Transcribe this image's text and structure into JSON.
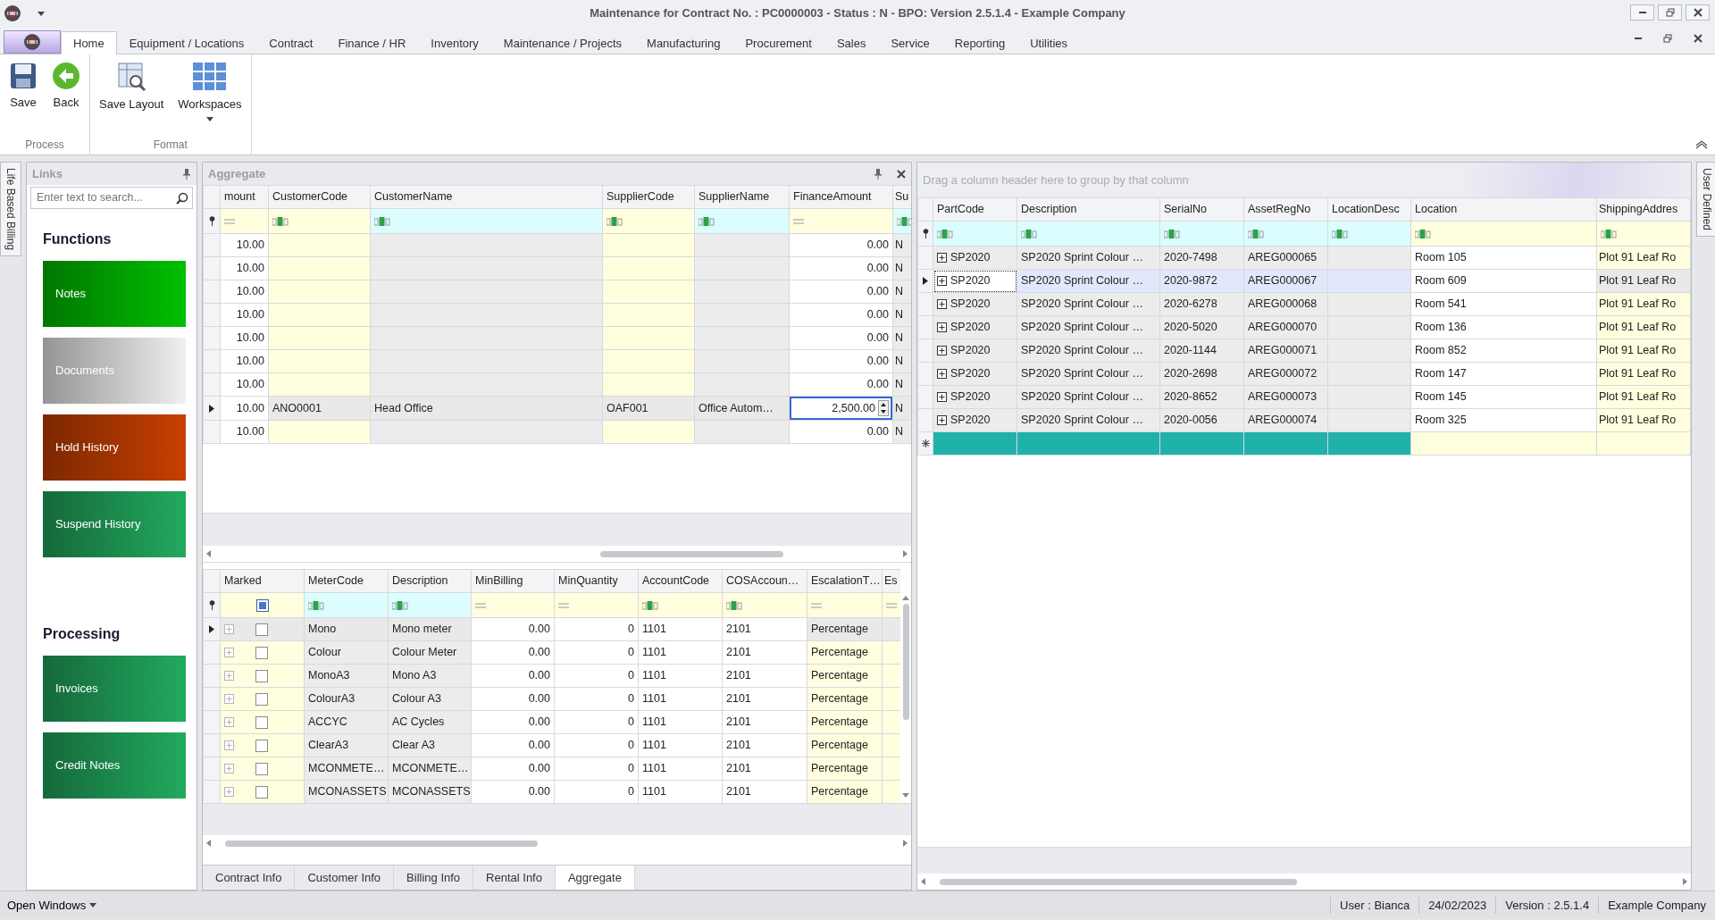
{
  "window": {
    "title": "Maintenance for Contract No. : PC0000003 - Status : N - BPO: Version 2.5.1.4 - Example Company"
  },
  "ribbon_tabs": [
    {
      "label": "Home",
      "selected": true
    },
    {
      "label": "Equipment / Locations",
      "selected": false
    },
    {
      "label": "Contract",
      "selected": false
    },
    {
      "label": "Finance / HR",
      "selected": false
    },
    {
      "label": "Inventory",
      "selected": false
    },
    {
      "label": "Maintenance / Projects",
      "selected": false
    },
    {
      "label": "Manufacturing",
      "selected": false
    },
    {
      "label": "Procurement",
      "selected": false
    },
    {
      "label": "Sales",
      "selected": false
    },
    {
      "label": "Service",
      "selected": false
    },
    {
      "label": "Reporting",
      "selected": false
    },
    {
      "label": "Utilities",
      "selected": false
    }
  ],
  "ribbon_groups": [
    {
      "label": "Process",
      "buttons": [
        {
          "label": "Save",
          "kind": "save",
          "dropdown": false
        },
        {
          "label": "Back",
          "kind": "back",
          "dropdown": false
        }
      ]
    },
    {
      "label": "Format",
      "buttons": [
        {
          "label": "Save Layout",
          "kind": "layout",
          "dropdown": false
        },
        {
          "label": "Workspaces",
          "kind": "workspaces",
          "dropdown": true
        }
      ]
    }
  ],
  "left_side_tab": "Life Based Billing",
  "right_side_tab": "User Defined",
  "links": {
    "title": "Links",
    "search": {
      "placeholder": "Enter text to search..."
    },
    "sections": [
      {
        "heading": "Functions",
        "tiles": [
          {
            "label": "Notes",
            "color": "#00c000"
          },
          {
            "label": "Documents",
            "color": "#f0f0f0"
          },
          {
            "label": "Hold History",
            "color": "#c84000"
          },
          {
            "label": "Suspend History",
            "color": "#22aa5e"
          }
        ]
      },
      {
        "heading": "Processing",
        "tiles": [
          {
            "label": "Invoices",
            "color": "#22aa5e"
          },
          {
            "label": "Credit Notes",
            "color": "#22aa5e"
          }
        ]
      }
    ]
  },
  "aggregate": {
    "title": "Aggregate",
    "grid": {
      "columns": [
        {
          "label": "mount",
          "kind": "number"
        },
        {
          "label": "CustomerCode",
          "kind": "lookup"
        },
        {
          "label": "CustomerName",
          "kind": "readonly"
        },
        {
          "label": "SupplierCode",
          "kind": "lookup"
        },
        {
          "label": "SupplierName",
          "kind": "readonly"
        },
        {
          "label": "FinanceAmount",
          "kind": "spin"
        },
        {
          "label": "Su",
          "kind": "readonly"
        }
      ],
      "rows": [
        {
          "selected": false,
          "cells": [
            "10.00",
            null,
            null,
            null,
            null,
            "0.00",
            "N"
          ]
        },
        {
          "selected": false,
          "cells": [
            "10.00",
            null,
            null,
            null,
            null,
            "0.00",
            "N"
          ]
        },
        {
          "selected": false,
          "cells": [
            "10.00",
            null,
            null,
            null,
            null,
            "0.00",
            "N"
          ]
        },
        {
          "selected": false,
          "cells": [
            "10.00",
            null,
            null,
            null,
            null,
            "0.00",
            "N"
          ]
        },
        {
          "selected": false,
          "cells": [
            "10.00",
            null,
            null,
            null,
            null,
            "0.00",
            "N"
          ]
        },
        {
          "selected": false,
          "cells": [
            "10.00",
            null,
            null,
            null,
            null,
            "0.00",
            "N"
          ]
        },
        {
          "selected": false,
          "cells": [
            "10.00",
            null,
            null,
            null,
            null,
            "0.00",
            "N"
          ]
        },
        {
          "selected": true,
          "cells": [
            "10.00",
            "ANO0001",
            "Head Office",
            "OAF001",
            "Office Autom…",
            "2,500.00",
            "N"
          ]
        },
        {
          "selected": false,
          "cells": [
            "10.00",
            null,
            null,
            null,
            null,
            "0.00",
            "N"
          ]
        }
      ]
    },
    "detail_grid": {
      "columns": [
        {
          "label": "Marked",
          "kind": "check"
        },
        {
          "label": "MeterCode",
          "kind": "readonly"
        },
        {
          "label": "Description",
          "kind": "readonly"
        },
        {
          "label": "MinBilling",
          "kind": "number"
        },
        {
          "label": "MinQuantity",
          "kind": "number"
        },
        {
          "label": "AccountCode",
          "kind": "text"
        },
        {
          "label": "COSAccoun…",
          "kind": "text"
        },
        {
          "label": "EscalationT…",
          "kind": "choice"
        },
        {
          "label": "Es",
          "kind": "choice"
        }
      ],
      "rows": [
        {
          "selected": true,
          "expanded": false,
          "checked": false,
          "cells": [
            null,
            "Mono",
            "Mono meter",
            "0.00",
            "0",
            "1101",
            "2101",
            "Percentage",
            null
          ]
        },
        {
          "selected": false,
          "expanded": false,
          "checked": false,
          "cells": [
            null,
            "Colour",
            "Colour Meter",
            "0.00",
            "0",
            "1101",
            "2101",
            "Percentage",
            null
          ]
        },
        {
          "selected": false,
          "expanded": false,
          "checked": false,
          "cells": [
            null,
            "MonoA3",
            "Mono A3",
            "0.00",
            "0",
            "1101",
            "2101",
            "Percentage",
            null
          ]
        },
        {
          "selected": false,
          "expanded": false,
          "checked": false,
          "cells": [
            null,
            "ColourA3",
            "Colour A3",
            "0.00",
            "0",
            "1101",
            "2101",
            "Percentage",
            null
          ]
        },
        {
          "selected": false,
          "expanded": false,
          "checked": false,
          "cells": [
            null,
            "ACCYC",
            "AC Cycles",
            "0.00",
            "0",
            "1101",
            "2101",
            "Percentage",
            null
          ]
        },
        {
          "selected": false,
          "expanded": false,
          "checked": false,
          "cells": [
            null,
            "ClearA3",
            "Clear A3",
            "0.00",
            "0",
            "1101",
            "2101",
            "Percentage",
            null
          ]
        },
        {
          "selected": false,
          "expanded": false,
          "checked": false,
          "cells": [
            null,
            "MCONMETE…",
            "MCONMETE…",
            "0.00",
            "0",
            "1101",
            "2101",
            "Percentage",
            null
          ]
        },
        {
          "selected": false,
          "expanded": false,
          "checked": false,
          "cells": [
            null,
            "MCONASSETS",
            "MCONASSETS",
            "0.00",
            "0",
            "1101",
            "2101",
            "Percentage",
            null
          ]
        }
      ]
    },
    "tabs": [
      {
        "label": "Contract Info",
        "selected": false
      },
      {
        "label": "Customer Info",
        "selected": false
      },
      {
        "label": "Billing Info",
        "selected": false
      },
      {
        "label": "Rental Info",
        "selected": false
      },
      {
        "label": "Aggregate",
        "selected": true
      }
    ]
  },
  "equipment": {
    "group_panel_hint": "Drag a column header here to group by that column",
    "grid": {
      "columns": [
        {
          "label": "PartCode",
          "kind": "tree"
        },
        {
          "label": "Description",
          "kind": "readonly"
        },
        {
          "label": "SerialNo",
          "kind": "readonly"
        },
        {
          "label": "AssetRegNo",
          "kind": "readonly"
        },
        {
          "label": "LocationDesc",
          "kind": "readonly"
        },
        {
          "label": "Location",
          "kind": "text"
        },
        {
          "label": "ShippingAddres",
          "kind": "lookup"
        }
      ],
      "rows": [
        {
          "kind": "data",
          "selected": false,
          "expanded": false,
          "cells": [
            "SP2020",
            "SP2020 Sprint Colour …",
            "2020-7498",
            "AREG000065",
            null,
            "Room 105",
            "Plot 91 Leaf Ro"
          ]
        },
        {
          "kind": "data",
          "selected": true,
          "expanded": false,
          "cells": [
            "SP2020",
            "SP2020 Sprint Colour …",
            "2020-9872",
            "AREG000067",
            null,
            "Room 609",
            "Plot 91 Leaf Ro"
          ]
        },
        {
          "kind": "data",
          "selected": false,
          "expanded": false,
          "cells": [
            "SP2020",
            "SP2020 Sprint Colour …",
            "2020-6278",
            "AREG000068",
            null,
            "Room 541",
            "Plot 91 Leaf Ro"
          ]
        },
        {
          "kind": "data",
          "selected": false,
          "expanded": false,
          "cells": [
            "SP2020",
            "SP2020 Sprint Colour …",
            "2020-5020",
            "AREG000070",
            null,
            "Room 136",
            "Plot 91 Leaf Ro"
          ]
        },
        {
          "kind": "data",
          "selected": false,
          "expanded": false,
          "cells": [
            "SP2020",
            "SP2020 Sprint Colour …",
            "2020-1144",
            "AREG000071",
            null,
            "Room 852",
            "Plot 91 Leaf Ro"
          ]
        },
        {
          "kind": "data",
          "selected": false,
          "expanded": false,
          "cells": [
            "SP2020",
            "SP2020 Sprint Colour …",
            "2020-2698",
            "AREG000072",
            null,
            "Room 147",
            "Plot 91 Leaf Ro"
          ]
        },
        {
          "kind": "data",
          "selected": false,
          "expanded": false,
          "cells": [
            "SP2020",
            "SP2020 Sprint Colour …",
            "2020-8652",
            "AREG000073",
            null,
            "Room 145",
            "Plot 91 Leaf Ro"
          ]
        },
        {
          "kind": "data",
          "selected": false,
          "expanded": false,
          "cells": [
            "SP2020",
            "SP2020 Sprint Colour …",
            "2020-0056",
            "AREG000074",
            null,
            "Room 325",
            "Plot 91 Leaf Ro"
          ]
        },
        {
          "kind": "new",
          "selected": false,
          "cells": [
            null,
            null,
            null,
            null,
            null,
            null,
            null
          ]
        }
      ]
    }
  },
  "status_bar": {
    "menu": "Open Windows",
    "items": [
      "User : Bianca",
      "24/02/2023",
      "Version : 2.5.1.4",
      "Example Company"
    ]
  }
}
